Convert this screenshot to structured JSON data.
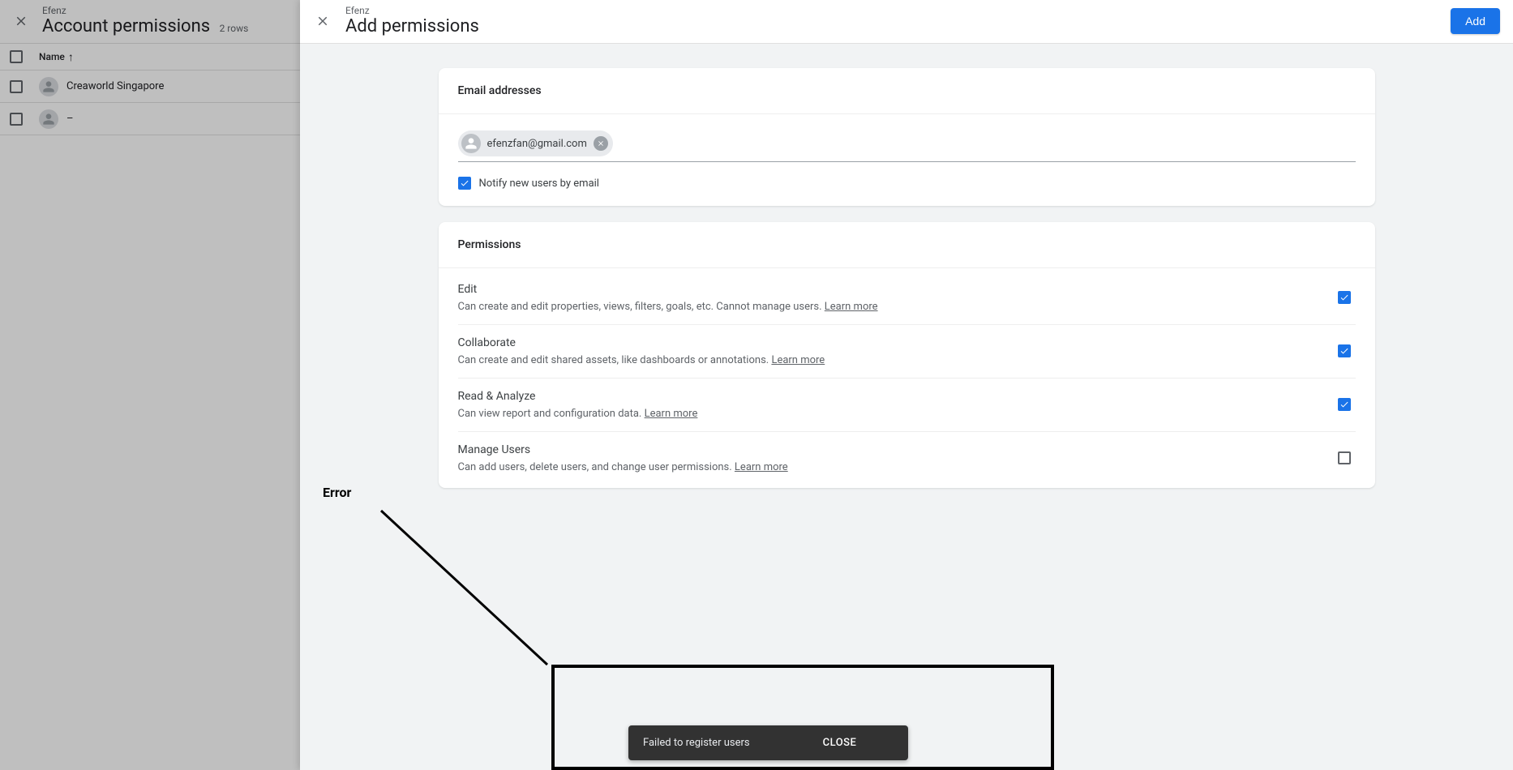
{
  "background": {
    "superTitle": "Efenz",
    "title": "Account permissions",
    "rowsLabel": "2 rows",
    "columnHeader": "Name",
    "sortArrow": "↑",
    "rows": [
      {
        "name": "Creaworld Singapore"
      },
      {
        "name": "–"
      }
    ]
  },
  "panel": {
    "superTitle": "Efenz",
    "title": "Add permissions",
    "addButton": "Add",
    "sections": {
      "emailTitle": "Email addresses",
      "emailChip": "efenzfan@gmail.com",
      "notifyLabel": "Notify new users by email",
      "permTitle": "Permissions",
      "perms": [
        {
          "title": "Edit",
          "desc": "Can create and edit properties, views, filters, goals, etc. Cannot manage users. ",
          "learn": "Learn more",
          "checked": true
        },
        {
          "title": "Collaborate",
          "desc": "Can create and edit shared assets, like dashboards or annotations. ",
          "learn": "Learn more",
          "checked": true
        },
        {
          "title": "Read & Analyze",
          "desc": "Can view report and configuration data. ",
          "learn": "Learn more",
          "checked": true
        },
        {
          "title": "Manage Users",
          "desc": "Can add users, delete users, and change user permissions. ",
          "learn": "Learn more",
          "checked": false
        }
      ]
    }
  },
  "annotation": {
    "label": "Error"
  },
  "toast": {
    "message": "Failed to register users",
    "close": "CLOSE"
  }
}
